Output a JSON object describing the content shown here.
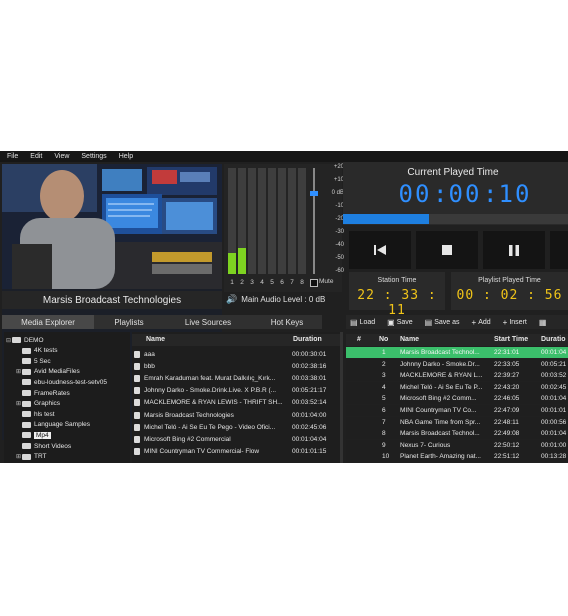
{
  "menu": [
    "File",
    "Edit",
    "View",
    "Settings",
    "Help"
  ],
  "video": {
    "title": "Marsis Broadcast Technologies"
  },
  "meters": {
    "channels": [
      "1",
      "2",
      "3",
      "4",
      "5",
      "6",
      "7",
      "8"
    ],
    "levels": [
      0.2,
      0.25,
      0,
      0,
      0,
      0,
      0,
      0
    ],
    "db_scale": [
      "+20",
      "+10",
      "0 dB",
      "-10",
      "-20",
      "-30",
      "-40",
      "-50",
      "-60"
    ],
    "mute_label": "Mute",
    "main_audio_label": "Main Audio Level : 0 dB"
  },
  "current_time": {
    "title": "Current Played Time",
    "hh": "00",
    "mm": "00",
    "ss": "10",
    "progress": 0.38
  },
  "transport": {
    "icons": [
      "skip-previous-icon",
      "stop-icon",
      "pause-icon",
      "next-icon"
    ]
  },
  "station_time": {
    "label": "Station Time",
    "value": "22 : 33 : 11"
  },
  "playlist_time": {
    "label": "Playlist Played Time",
    "value": "00 : 02 : 56"
  },
  "tabs": [
    "Media Explorer",
    "Playlists",
    "Live Sources",
    "Hot Keys"
  ],
  "tree": [
    {
      "label": "DEMO",
      "depth": 0,
      "expander": "⊟"
    },
    {
      "label": "4K tests",
      "depth": 1,
      "expander": ""
    },
    {
      "label": "5 Sec",
      "depth": 1,
      "expander": ""
    },
    {
      "label": "Avid MediaFiles",
      "depth": 1,
      "expander": "⊞"
    },
    {
      "label": "ebu-loudness-test-setv05",
      "depth": 1,
      "expander": ""
    },
    {
      "label": "FrameRates",
      "depth": 1,
      "expander": ""
    },
    {
      "label": "Graphics",
      "depth": 1,
      "expander": "⊞"
    },
    {
      "label": "hls test",
      "depth": 1,
      "expander": ""
    },
    {
      "label": "Language Samples",
      "depth": 1,
      "expander": ""
    },
    {
      "label": "Mp4",
      "depth": 1,
      "expander": ""
    },
    {
      "label": "Short Videos",
      "depth": 1,
      "expander": ""
    },
    {
      "label": "TRT",
      "depth": 1,
      "expander": "⊞"
    }
  ],
  "media": {
    "headers": {
      "name": "Name",
      "duration": "Duration"
    },
    "rows": [
      {
        "name": "aaa",
        "duration": "00:00:30:01"
      },
      {
        "name": "bbb",
        "duration": "00:02:38:16"
      },
      {
        "name": "Emrah Karaduman feat. Murat Dalkılıç_Kırk...",
        "duration": "00:03:38:01"
      },
      {
        "name": "Johnny Darko - Smoke.Drink.Live. X P.B.R (...",
        "duration": "00:05:21:17"
      },
      {
        "name": "MACKLEMORE & RYAN LEWIS - THRIFT SH...",
        "duration": "00:03:52:14"
      },
      {
        "name": "Marsis Broadcast Technologies",
        "duration": "00:01:04:00"
      },
      {
        "name": "Michel Teló - Ai Se Eu Te Pego - Video Ofici...",
        "duration": "00:02:45:06"
      },
      {
        "name": "Microsoft Bing #2 Commercial",
        "duration": "00:01:04:04"
      },
      {
        "name": "MINI Countryman TV Commercial- Flow",
        "duration": "00:01:01:15"
      }
    ]
  },
  "toolbar": {
    "load": "Load",
    "save": "Save",
    "save_as": "Save as",
    "add": "Add",
    "insert": "Insert"
  },
  "playlist": {
    "headers": {
      "hash": "#",
      "no": "No",
      "name": "Name",
      "start": "Start Time",
      "duration": "Duratio"
    },
    "rows": [
      {
        "no": "1",
        "name": "Marsis Broadcast Technol...",
        "start": "22:31:01",
        "duration": "00:01:04"
      },
      {
        "no": "2",
        "name": "Johnny Darko - Smoke.Dr...",
        "start": "22:33:05",
        "duration": "00:05:21"
      },
      {
        "no": "3",
        "name": "MACKLEMORE & RYAN L...",
        "start": "22:39:27",
        "duration": "00:03:52"
      },
      {
        "no": "4",
        "name": "Michel Teló - Ai Se Eu Te P...",
        "start": "22:43:20",
        "duration": "00:02:45"
      },
      {
        "no": "5",
        "name": "Microsoft Bing #2 Comm...",
        "start": "22:46:05",
        "duration": "00:01:04"
      },
      {
        "no": "6",
        "name": "MINI Countryman TV Co...",
        "start": "22:47:09",
        "duration": "00:01:01"
      },
      {
        "no": "7",
        "name": "NBA Game Time from Spr...",
        "start": "22:48:11",
        "duration": "00:00:56"
      },
      {
        "no": "8",
        "name": "Marsis Broadcast Technol...",
        "start": "22:49:08",
        "duration": "00:01:04"
      },
      {
        "no": "9",
        "name": "Nexus 7- Curious",
        "start": "22:50:12",
        "duration": "00:01:00"
      },
      {
        "no": "10",
        "name": "Planet Earth- Amazing nat...",
        "start": "22:51:12",
        "duration": "00:13:28"
      }
    ]
  },
  "colors": {
    "accent_blue": "#2f8fff",
    "digit_yellow": "#f0c419",
    "selected_row": "#3bbf6b",
    "meter_green": "#7ed321"
  }
}
